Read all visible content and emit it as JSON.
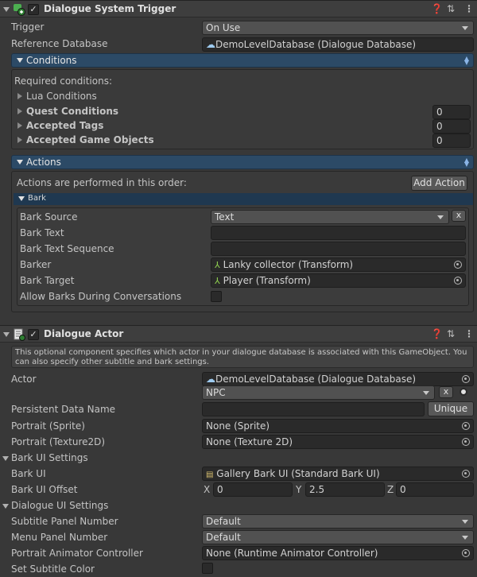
{
  "trigger_component": {
    "title": "Dialogue System Trigger",
    "trigger_label": "Trigger",
    "trigger_value": "On Use",
    "reference_db_label": "Reference Database",
    "reference_db_value": "DemoLevelDatabase (Dialogue Database)",
    "conditions": {
      "title": "Conditions",
      "required_label": "Required conditions:",
      "lua_label": "Lua Conditions",
      "quest_label": "Quest Conditions",
      "quest_value": "0",
      "tags_label": "Accepted Tags",
      "tags_value": "0",
      "objects_label": "Accepted Game Objects",
      "objects_value": "0"
    },
    "actions": {
      "title": "Actions",
      "order_label": "Actions are performed in this order:",
      "add_action": "Add Action",
      "bark": {
        "title": "Bark",
        "source_label": "Bark Source",
        "source_value": "Text",
        "remove": "x",
        "text_label": "Bark Text",
        "text_value": "",
        "sequence_label": "Bark Text Sequence",
        "sequence_value": "",
        "barker_label": "Barker",
        "barker_value": "Lanky collector (Transform)",
        "target_label": "Bark Target",
        "target_value": "Player (Transform)",
        "allow_label": "Allow Barks During Conversations"
      }
    }
  },
  "actor_component": {
    "title": "Dialogue Actor",
    "help_text": "This optional component specifies which actor in your dialogue database is associated with this GameObject. You can also specify other subtitle and bark settings.",
    "actor_label": "Actor",
    "actor_db_value": "DemoLevelDatabase (Dialogue Database)",
    "actor_value": "NPC",
    "actor_clear": "x",
    "persistent_label": "Persistent Data Name",
    "persistent_value": "",
    "unique_button": "Unique",
    "portrait_sprite_label": "Portrait (Sprite)",
    "portrait_sprite_value": "None (Sprite)",
    "portrait_tex_label": "Portrait (Texture2D)",
    "portrait_tex_value": "None (Texture 2D)",
    "bark_ui_settings": "Bark UI Settings",
    "bark_ui_label": "Bark UI",
    "bark_ui_value": "Gallery Bark UI (Standard Bark UI)",
    "bark_offset_label": "Bark UI Offset",
    "offset_x_label": "X",
    "offset_x": "0",
    "offset_y_label": "Y",
    "offset_y": "2.5",
    "offset_z_label": "Z",
    "offset_z": "0",
    "dialogue_ui_settings": "Dialogue UI Settings",
    "subtitle_panel_label": "Subtitle Panel Number",
    "subtitle_panel_value": "Default",
    "menu_panel_label": "Menu Panel Number",
    "menu_panel_value": "Default",
    "portrait_anim_label": "Portrait Animator Controller",
    "portrait_anim_value": "None (Runtime Animator Controller)",
    "subtitle_color_label": "Set Subtitle Color"
  }
}
